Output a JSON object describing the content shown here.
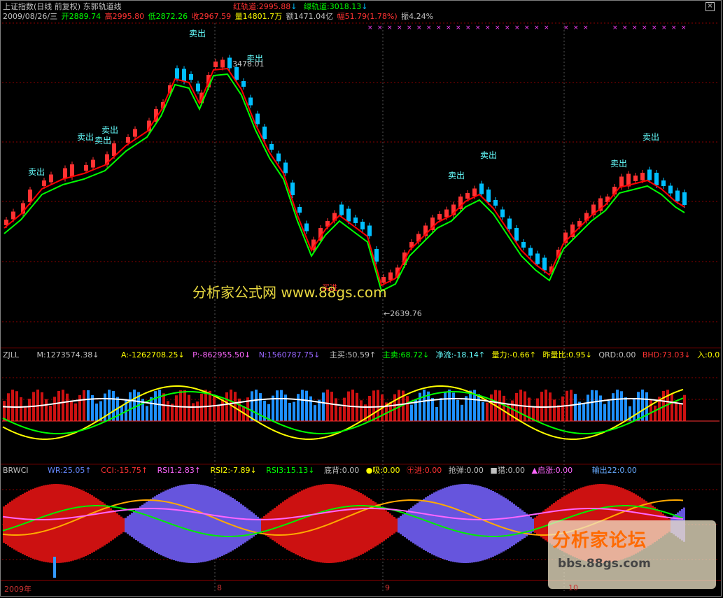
{
  "header": {
    "title": "上证指数(日线 前复权) 东郭轨道线",
    "red_track": "红轨道:2995.88",
    "green_track": "绿轨道:3018.13",
    "date": "2009/08/26/三",
    "open": "开2889.74",
    "high": "高2995.80",
    "low": "低2872.26",
    "close": "收2967.59",
    "volume": "量14801.7万",
    "amount": "额1471.04亿",
    "change": "幅51.79(1.78%)",
    "amplitude": "振4.24%"
  },
  "main_chart": {
    "max_label": "3478.01",
    "min_label": "←2639.76",
    "sell_label": "卖出",
    "buy_label": "买进",
    "watermark": "分析家公式网 www.88gs.com"
  },
  "zjll": {
    "name": "ZJLL",
    "m": "M:1273574.38↓",
    "a": "A:-1262708.25↓",
    "p": "P:-862955.50↓",
    "n": "N:1560787.75↓",
    "zhumai": "主买:50.59↑",
    "zhumai2": "主卖:68.72↓",
    "jingliu": "净流:-18.14↑",
    "liangli": "量力:-0.66↑",
    "zuoliangbi": "昨量比:0.95↓",
    "qrd": "QRD:0.00",
    "bhd": "BHD:73.03↓",
    "ru": "入:0.0"
  },
  "brwci": {
    "name": "BRWCI",
    "wr": "WR:25.05↑",
    "cci": "CCI:-15.75↑",
    "rsi1": "RSI1:2.83↑",
    "rsi2": "RSI2:-7.89↓",
    "rsi3": "RSI3:15.13↓",
    "dibei": "底背:0.00",
    "xi": "●吸:0.00",
    "jin": "㊉进:0.00",
    "qiangtan": "抢弹:0.00",
    "lie": "■猎:0.00",
    "qizhang": "▲启涨:0.00",
    "shuchu": "输出22:0.00"
  },
  "axis": {
    "year": "2009年",
    "m8": "8",
    "m9": "9",
    "m10": "10"
  },
  "forum": {
    "title": "分析家论坛",
    "url": "bbs.88gs.com"
  },
  "colors": {
    "up": "#ff3232",
    "down": "#00bfff",
    "ma_red": "#ff0000",
    "ma_green": "#00ff00",
    "label_cyan": "#66ffff"
  }
}
